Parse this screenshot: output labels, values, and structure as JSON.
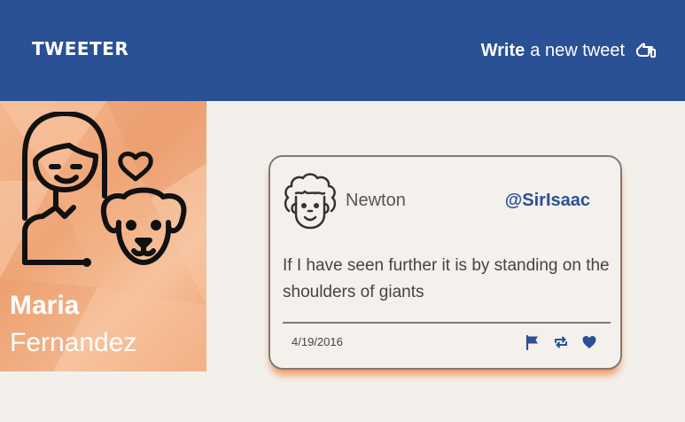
{
  "header": {
    "brand": "TWEETER",
    "write_strong": "Write",
    "write_rest": "a new tweet",
    "write_icon": "pointing-hand-icon"
  },
  "profile": {
    "first_name": "Maria",
    "last_name": "Fernandez",
    "avatar_icon": "girl-with-dog-icon"
  },
  "tweet": {
    "author": "Newton",
    "handle": "@SirIsaac",
    "text": "If I have seen further it is by standing on the shoulders of giants",
    "date": "4/19/2016",
    "avatar_icon": "newton-face-icon",
    "actions": [
      "flag-icon",
      "retweet-icon",
      "heart-icon"
    ]
  },
  "colors": {
    "header_bg": "#2a5195",
    "profile_bg": "#efa576",
    "accent_shadow": "#f08a4b",
    "handle": "#2a5195"
  }
}
